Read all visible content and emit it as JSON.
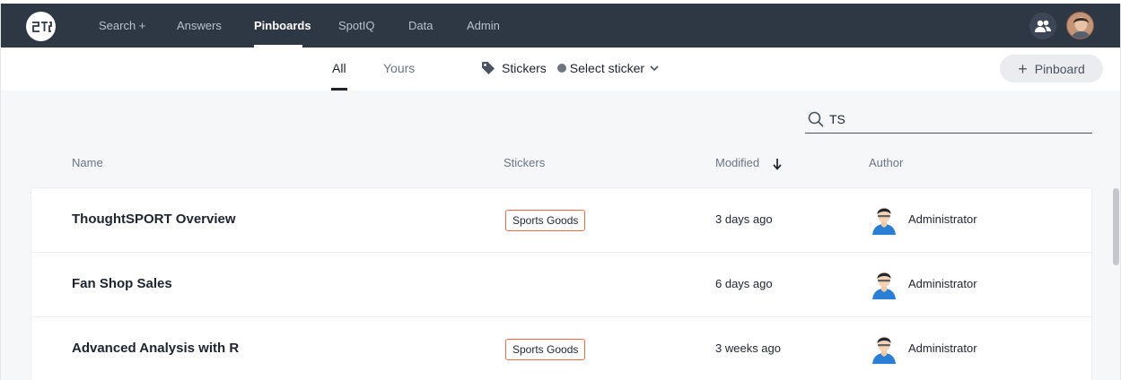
{
  "nav": {
    "logo_icon": "thoughtspot-logo",
    "items": [
      {
        "label": "Search +"
      },
      {
        "label": "Answers"
      },
      {
        "label": "Pinboards",
        "active": true
      },
      {
        "label": "SpotIQ"
      },
      {
        "label": "Data"
      },
      {
        "label": "Admin"
      }
    ],
    "people_icon": "people-icon",
    "avatar_icon": "user-avatar"
  },
  "subbar": {
    "tabs": [
      {
        "label": "All",
        "active": true
      },
      {
        "label": "Yours"
      }
    ],
    "stickers_label": "Stickers",
    "select_sticker_label": "Select sticker",
    "add_pinboard_label": "Pinboard"
  },
  "search": {
    "value": "TS",
    "icon": "search-icon"
  },
  "table": {
    "columns": {
      "name": "Name",
      "stickers": "Stickers",
      "modified": "Modified",
      "author": "Author"
    },
    "sort_icon": "arrow-down-icon",
    "rows": [
      {
        "name": "ThoughtSPORT Overview",
        "sticker": "Sports Goods",
        "modified": "3 days ago",
        "author": "Administrator"
      },
      {
        "name": "Fan Shop Sales",
        "sticker": "",
        "modified": "6 days ago",
        "author": "Administrator"
      },
      {
        "name": "Advanced Analysis with R",
        "sticker": "Sports Goods",
        "modified": "3 weeks ago",
        "author": "Administrator"
      }
    ]
  },
  "colors": {
    "nav_bg": "#2e3744",
    "sticker_border": "#ef6b3a",
    "page_bg": "#f6f7f9"
  }
}
